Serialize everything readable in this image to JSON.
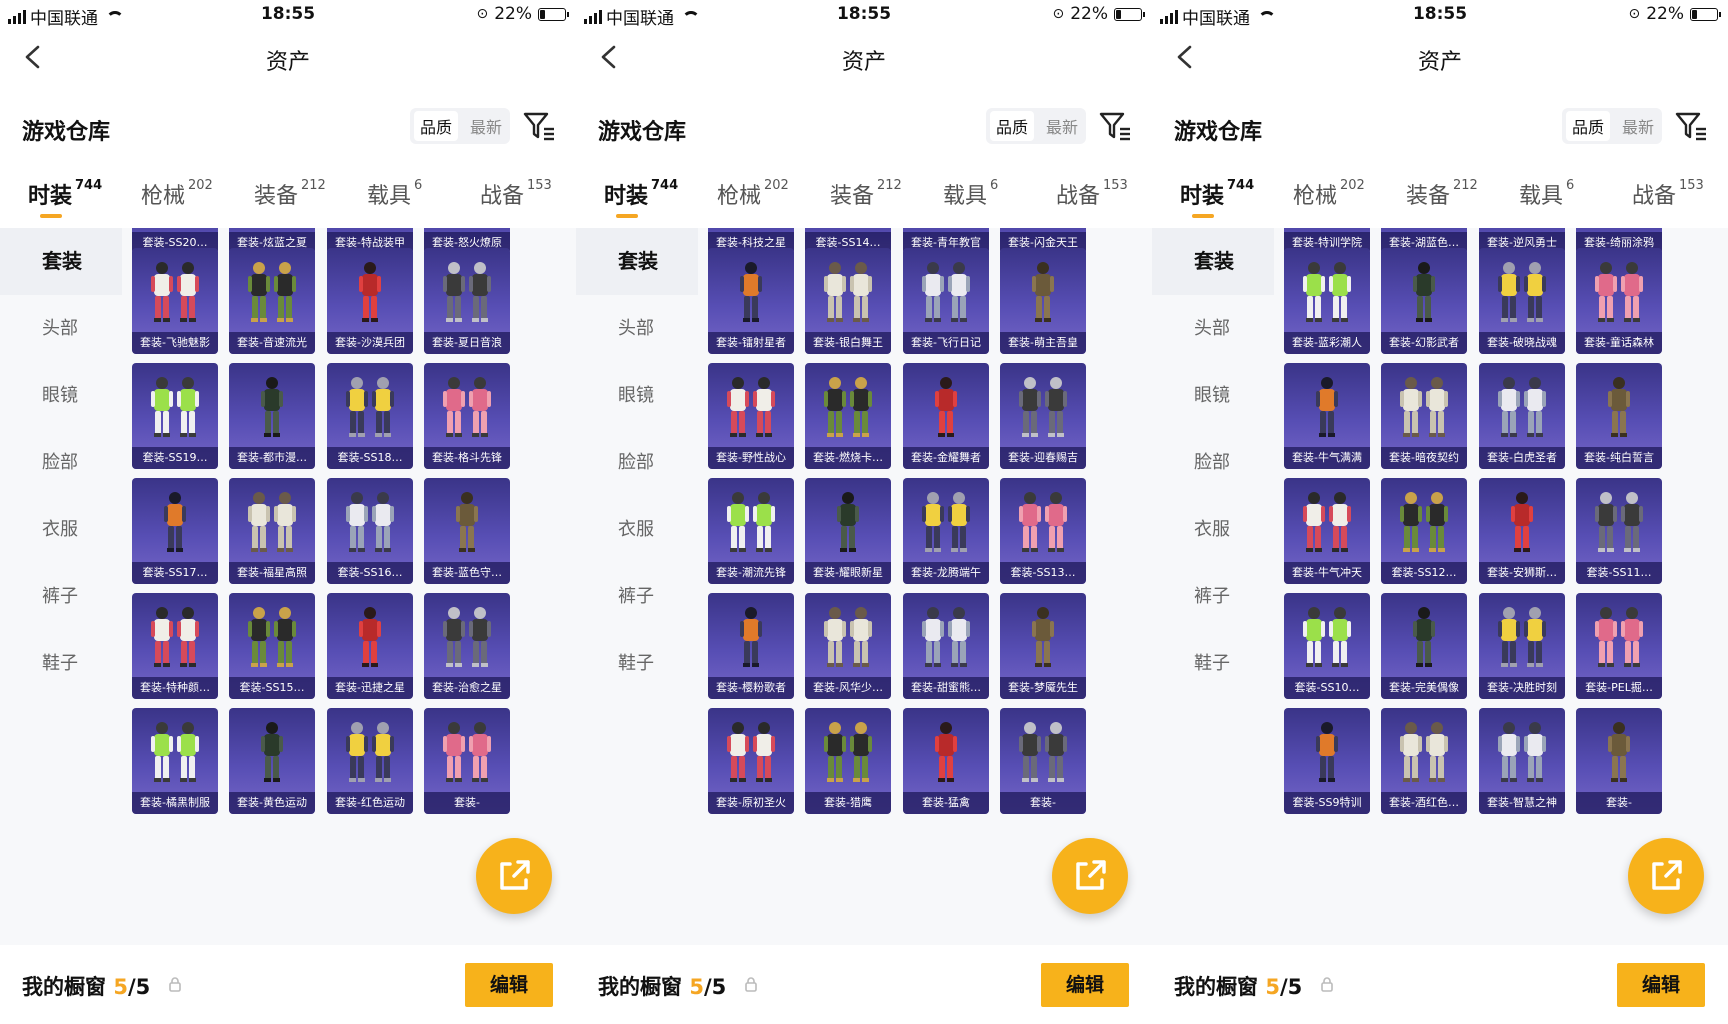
{
  "status": {
    "carrier": "中国联通",
    "time": "18:55",
    "battery": "22%",
    "battery_level": 0.22
  },
  "nav": {
    "title": "资产"
  },
  "warehouse": {
    "title": "游戏仓库",
    "sort_quality": "品质",
    "sort_latest": "最新"
  },
  "tabs": [
    {
      "label": "时装",
      "count": "744"
    },
    {
      "label": "枪械",
      "count": "202"
    },
    {
      "label": "装备",
      "count": "212"
    },
    {
      "label": "载具",
      "count": "6"
    },
    {
      "label": "战备",
      "count": "153"
    }
  ],
  "sidebar": [
    "套装",
    "头部",
    "眼镜",
    "脸部",
    "衣服",
    "裤子",
    "鞋子"
  ],
  "showcase": {
    "label": "我的橱窗",
    "current": "5",
    "total": "/5",
    "edit": "编辑"
  },
  "colors": {
    "accent": "#f7b21b",
    "card_top": "#3a3488",
    "card_bottom": "#7566c7"
  },
  "icons": {
    "back": "chevron-left-icon",
    "filter": "filter-icon",
    "share": "share-external-icon",
    "lock": "lock-icon"
  },
  "panels": [
    {
      "top_partial": [
        "套装-SS20…",
        "套装-炫蓝之夏",
        "套装-特战装甲",
        "套装-怒火燎原"
      ],
      "rows": [
        [
          "套装-飞驰魅影",
          "套装-音速流光",
          "套装-沙漠兵团",
          "套装-夏日音浪"
        ],
        [
          "套装-SS19…",
          "套装-都市漫…",
          "套装-SS18…",
          "套装-格斗先锋"
        ],
        [
          "套装-SS17…",
          "套装-福星高照",
          "套装-SS16…",
          "套装-蓝色守…"
        ],
        [
          "套装-特种颜…",
          "套装-SS15…",
          "套装-迅捷之星",
          "套装-治愈之星"
        ],
        [
          "套装-橘黑制服",
          "套装-黄色运动",
          "套装-红色运动",
          "套装-"
        ]
      ]
    },
    {
      "top_partial": [
        "套装-科技之星",
        "套装-SS14…",
        "套装-青年教官",
        "套装-闪金天王"
      ],
      "rows": [
        [
          "套装-镭射星者",
          "套装-银白舞王",
          "套装-飞行日记",
          "套装-萌主吾皇"
        ],
        [
          "套装-野性战心",
          "套装-燃烧卡…",
          "套装-金耀舞者",
          "套装-迎春赐吉"
        ],
        [
          "套装-潮流先锋",
          "套装-耀眼新星",
          "套装-龙腾端午",
          "套装-SS13…"
        ],
        [
          "套装-樱粉歌者",
          "套装-风华少…",
          "套装-甜蜜熊…",
          "套装-梦魇先生"
        ],
        [
          "套装-原初圣火",
          "套装-猎鹰",
          "套装-猛禽",
          "套装-"
        ]
      ]
    },
    {
      "top_partial": [
        "套装-特训学院",
        "套装-湖蓝色…",
        "套装-逆风勇士",
        "套装-绮丽涂鸦"
      ],
      "rows": [
        [
          "套装-蓝彩潮人",
          "套装-幻影武者",
          "套装-破晓战魂",
          "套装-童话森林"
        ],
        [
          "套装-牛气满满",
          "套装-暗夜契约",
          "套装-白虎圣者",
          "套装-纯白誓言"
        ],
        [
          "套装-牛气冲天",
          "套装-SS12…",
          "套装-安狮斯…",
          "套装-SS11…"
        ],
        [
          "套装-SS10…",
          "套装-完美偶像",
          "套装-决胜时刻",
          "套装-PEL掘…"
        ],
        [
          "套装-SS9特训",
          "套装-酒红色…",
          "套装-智慧之神",
          "套装-"
        ]
      ]
    }
  ]
}
